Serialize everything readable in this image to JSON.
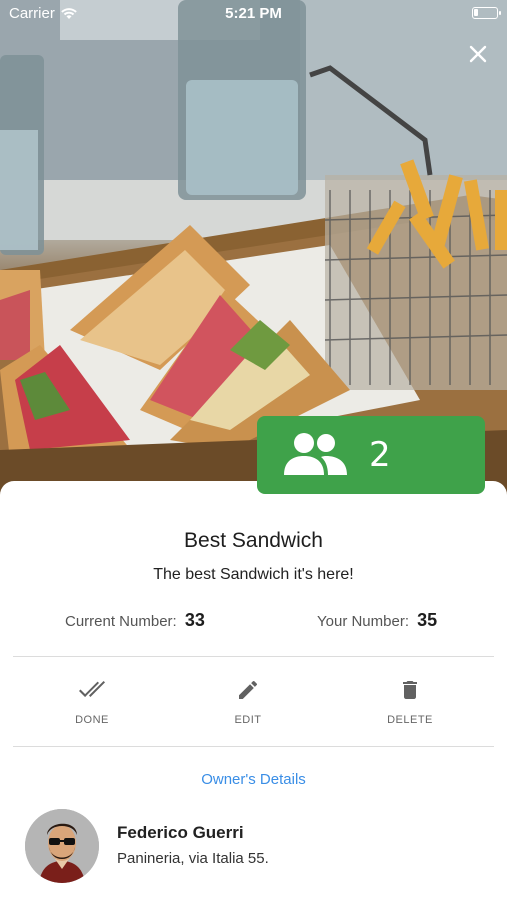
{
  "status_bar": {
    "carrier": "Carrier",
    "time": "5:21 PM"
  },
  "hero": {
    "people_count": "2",
    "badge_color": "#3fa24a"
  },
  "product": {
    "title": "Best Sandwich",
    "description": "The best Sandwich it's here!",
    "current_number_label": "Current Number:",
    "current_number": "33",
    "your_number_label": "Your Number:",
    "your_number": "35"
  },
  "actions": [
    {
      "label": "DONE",
      "icon": "double-check-icon"
    },
    {
      "label": "EDIT",
      "icon": "pencil-icon"
    },
    {
      "label": "DELETE",
      "icon": "trash-icon"
    }
  ],
  "owner": {
    "link_label": "Owner's Details",
    "name": "Federico Guerri",
    "address": "Panineria, via Italia 55."
  },
  "colors": {
    "accent": "#3a8ee6",
    "badge": "#3fa24a"
  }
}
